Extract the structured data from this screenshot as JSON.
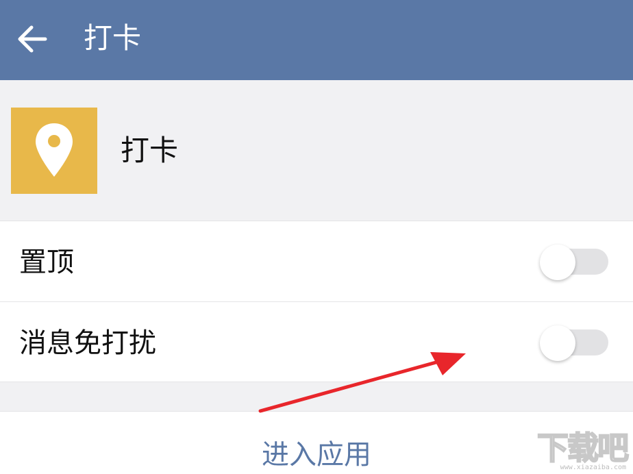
{
  "header": {
    "title": "打卡",
    "back_icon": "arrow-left-icon",
    "background_color": "#5a78a6"
  },
  "app_info": {
    "name": "打卡",
    "icon": "location-pin-icon",
    "icon_background_color": "#e8b84a"
  },
  "settings": [
    {
      "label": "置顶",
      "toggle_on": false
    },
    {
      "label": "消息免打扰",
      "toggle_on": false
    }
  ],
  "actions": {
    "enter_app_label": "进入应用",
    "accent_color": "#5a78a6"
  },
  "annotation": {
    "arrow_color": "#e8262b",
    "points_to": "消息免打扰 toggle"
  },
  "watermark": {
    "text": "下载吧",
    "url": "www.xiazaiba.com"
  }
}
